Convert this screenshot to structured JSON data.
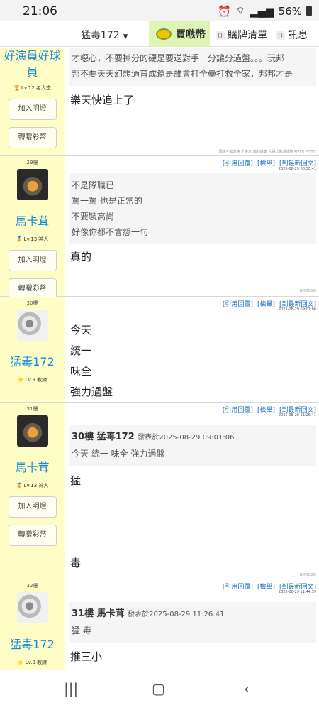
{
  "status_bar": {
    "time": "21:06",
    "battery": "56%"
  },
  "top_nav": {
    "user": "猛毒172",
    "coin_label": "買嗾幣",
    "cart_count": "0",
    "cart_label": "購牌清單",
    "msg_count": "0",
    "msg_label": "訊息"
  },
  "actions": {
    "quote": "[引用回覆]",
    "report": "[檢舉]",
    "latest": "[到最新回文]",
    "join": "加入明燈",
    "gift": "轉贈彩幣"
  },
  "posts": [
    {
      "user": "好演員好球員",
      "level": "Lv.12 名人堂",
      "quote_lines": [
        "才噁心，不要掉分的硬是要送對手一分讓分過盤。。。玩邦",
        "邦不要天天幻想過育成還是誰會打全壘打救全家，邦邦才是"
      ],
      "body": [
        "樂天快追上了"
      ],
      "sig": "國家手套首席 千金玩 輸的維泰 大哥比救還維持 叮叮?! 叮叮?!"
    },
    {
      "floor": "29樓",
      "user": "馬卡茸",
      "level": "Lv.13 神人",
      "time": "2025-08-29 08:30:41",
      "quote_lines": [
        "不是隊職已",
        "罵一罵 也是正常的",
        "不要裝高尚",
        "好像你都不會怨一句"
      ],
      "body": [
        "真的"
      ],
      "sig": "GOGOGO"
    },
    {
      "floor": "30樓",
      "user": "猛毒172",
      "level": "Lv.9 教練",
      "time": "2025-08-29 09:01:06",
      "body": [
        "今天",
        "統一",
        "味全",
        "強力過盤"
      ]
    },
    {
      "floor": "31樓",
      "user": "馬卡茸",
      "level": "Lv.13 神人",
      "time": "2025-08-29 11:26:41",
      "quote_head": "30樓 猛毒172",
      "quote_date": "發表於2025-08-29 09:01:06",
      "quote_lines": [
        "今天 統一 味全 強力過盤"
      ],
      "body": [
        "猛",
        "毒"
      ],
      "sig": "GOGOGO"
    },
    {
      "floor": "32樓",
      "user": "猛毒172",
      "level": "Lv.9 教練",
      "time": "2025-08-29 11:44:59",
      "quote_head": "31樓 馬卡茸",
      "quote_date": "發表於2025-08-29 11:26:41",
      "quote_lines": [
        "猛 毒"
      ],
      "body": [
        "推三小"
      ]
    }
  ],
  "icons": {
    "coin": "coin-icon",
    "recent": "recent-apps-icon",
    "home": "home-icon",
    "back": "back-icon"
  }
}
